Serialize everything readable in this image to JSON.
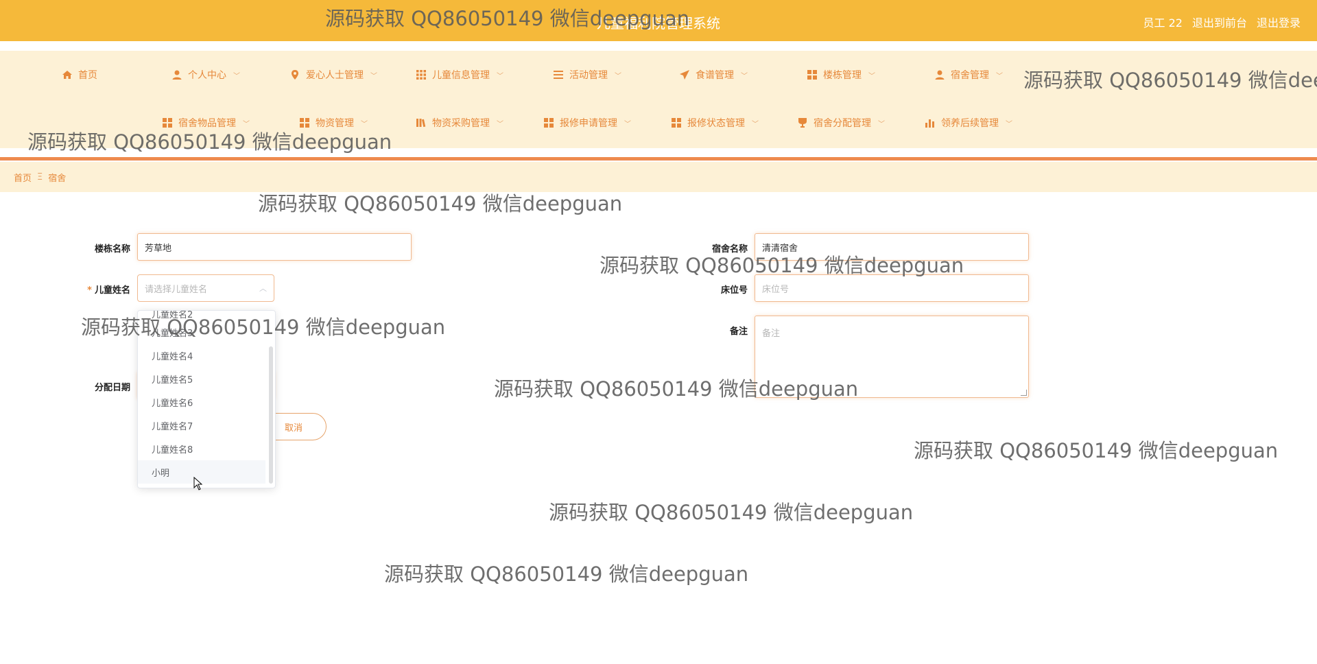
{
  "header": {
    "title": "儿童福利院管理系统",
    "user": "员工 22",
    "back_to_front": "退出到前台",
    "logout": "退出登录"
  },
  "nav": {
    "row1": [
      {
        "label": "首页",
        "icon": "home-icon",
        "dropdown": false
      },
      {
        "label": "个人中心",
        "icon": "user-icon",
        "dropdown": true
      },
      {
        "label": "爱心人士管理",
        "icon": "location-pin-icon",
        "dropdown": true
      },
      {
        "label": "儿童信息管理",
        "icon": "grid-icon",
        "dropdown": true
      },
      {
        "label": "活动管理",
        "icon": "list-icon",
        "dropdown": true
      },
      {
        "label": "食谱管理",
        "icon": "send-icon",
        "dropdown": true
      },
      {
        "label": "楼栋管理",
        "icon": "grid-icon",
        "dropdown": true
      },
      {
        "label": "宿舍管理",
        "icon": "user-icon",
        "dropdown": true
      }
    ],
    "row2": [
      {
        "label": "宿舍物品管理",
        "icon": "grid-icon",
        "dropdown": true
      },
      {
        "label": "物资管理",
        "icon": "grid-icon",
        "dropdown": true
      },
      {
        "label": "物资采购管理",
        "icon": "library-icon",
        "dropdown": true
      },
      {
        "label": "报修申请管理",
        "icon": "grid-icon",
        "dropdown": true
      },
      {
        "label": "报修状态管理",
        "icon": "grid-icon",
        "dropdown": true
      },
      {
        "label": "宿舍分配管理",
        "icon": "trophy-icon",
        "dropdown": true
      },
      {
        "label": "领养后续管理",
        "icon": "bar-chart-icon",
        "dropdown": true
      }
    ]
  },
  "breadcrumb": {
    "home": "首页",
    "separator": "Ξ",
    "current": "宿舍"
  },
  "form": {
    "building_label": "楼栋名称",
    "building_value": "芳草地",
    "dorm_label": "宿舍名称",
    "dorm_value": "清清宿舍",
    "child_label": "儿童姓名",
    "child_placeholder": "请选择儿童姓名",
    "bed_label": "床位号",
    "bed_placeholder": "床位号",
    "remark_label": "备注",
    "remark_placeholder": "备注",
    "date_label": "分配日期",
    "cancel_label": "取消"
  },
  "dropdown": {
    "partial_top": "儿童姓名2",
    "items": [
      "儿童姓名3",
      "儿童姓名4",
      "儿童姓名5",
      "儿童姓名6",
      "儿童姓名7",
      "儿童姓名8",
      "小明"
    ],
    "hovered": "小明"
  },
  "watermark": "源码获取 QQ86050149 微信deepguan",
  "colors": {
    "header": "#f5b93a",
    "nav_bg": "#fdf1d6",
    "accent": "#e6883a",
    "border": "#f0b98f"
  }
}
